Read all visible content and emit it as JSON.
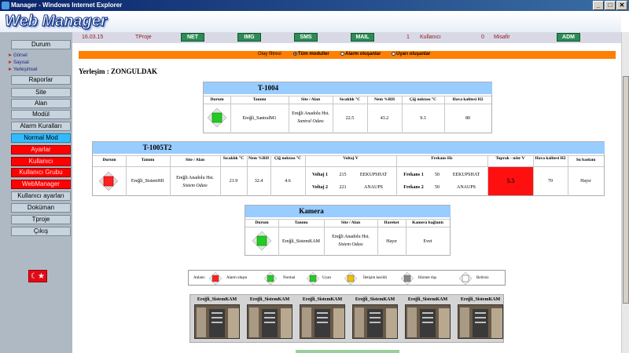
{
  "window": {
    "title": "Manager - Windows Internet Explorer",
    "min": "_",
    "max": "□",
    "close": "✕"
  },
  "app": {
    "logo": "Web Manager"
  },
  "status": {
    "date": "16.03.15",
    "project": "TProje",
    "buttons": [
      "NET",
      "IMG",
      "SMS",
      "MAIL",
      "ADM"
    ],
    "user_count": "1",
    "user_label": "Kullanıcı",
    "guest_count": "0",
    "guest_label": "Misafir"
  },
  "menu": {
    "durum": "Durum",
    "sub": [
      "Görsel",
      "Sayısal",
      "Yerleşimsel"
    ],
    "items": [
      {
        "label": "Raporlar",
        "style": "normal"
      },
      {
        "label": "Site",
        "style": "normal"
      },
      {
        "label": "Alan",
        "style": "normal"
      },
      {
        "label": "Modül",
        "style": "normal"
      },
      {
        "label": "Alarm Kuralları",
        "style": "normal"
      },
      {
        "label": "Normal Mod",
        "style": "cyan"
      },
      {
        "label": "Ayarlar",
        "style": "red"
      },
      {
        "label": "Kullanıcı",
        "style": "red"
      },
      {
        "label": "Kullanıcı Grubu",
        "style": "red"
      },
      {
        "label": "WebManager",
        "style": "red"
      },
      {
        "label": "Kullanıcı ayarları",
        "style": "normal"
      },
      {
        "label": "Doküman",
        "style": "normal"
      },
      {
        "label": "Tproje",
        "style": "normal"
      },
      {
        "label": "Çıkış",
        "style": "normal"
      }
    ]
  },
  "filter": {
    "label": "Olay filtresi",
    "options": [
      "Tüm moduller",
      "Alarm oluşanlar",
      "Uyarı oluşanlar"
    ],
    "selected": "Tüm moduller"
  },
  "location": "Yerleşim : ZONGULDAK",
  "panel1": {
    "title": "T-1004",
    "headers": [
      "Durum",
      "Tanımı",
      "Site / Alan",
      "Sıcaklık °C",
      "Nem %RH",
      "Çiğ noktası °C",
      "Hava kalitesi H2"
    ],
    "row": {
      "status": "normal",
      "name": "Ereğli_SantralM1",
      "site": "Ereğli Anadolu Hst.",
      "area": "Santral Odası",
      "temp": "22.5",
      "humidity": "43.2",
      "dew": "9.3",
      "air": "80"
    }
  },
  "panel2": {
    "title": "T-1005T2",
    "headers": [
      "Durum",
      "Tanımı",
      "Site / Alan",
      "Sıcaklık °C",
      "Nem %RH",
      "Çiğ noktası °C",
      "Voltaj V",
      "Frekans Hz",
      "Toprak - nötr V",
      "Hava kalitesi H2",
      "Su baskını"
    ],
    "row": {
      "status": "alarm",
      "name": "Ereğli_SistemM1",
      "site": "Ereğli Anadolu Hst.",
      "area": "Sistem Odası",
      "temp": "21.9",
      "humidity": "32.4",
      "dew": "4.6",
      "v1_label": "Voltaj 1",
      "v1": "215",
      "v1_name": "EEKUPSHAT",
      "v2_label": "Voltaj 2",
      "v2": "221",
      "v2_name": "ANAUPS",
      "f1_label": "Frekans 1",
      "f1": "50",
      "f1_name": "EEKUPSHAT",
      "f2_label": "Frekans 2",
      "f2": "50",
      "f2_name": "ANAUPS",
      "earth": "5.5",
      "air": "70",
      "flood": "Hayır"
    }
  },
  "panel3": {
    "title": "Kamera",
    "headers": [
      "Durum",
      "Tanımı",
      "Site / Alan",
      "Hareket",
      "Kamera bağlantı"
    ],
    "row": {
      "status": "normal",
      "name": "Ereğli_SistemKAM",
      "site": "Ereğli Anadolu Hst.",
      "area": "Sistem Odası",
      "motion": "Hayır",
      "conn": "Evet"
    }
  },
  "legend": {
    "title": "Anlam:",
    "items": [
      {
        "label": "Alarm oluştu",
        "color": "#ff2020"
      },
      {
        "label": "Normal",
        "color": "#22cc22"
      },
      {
        "label": "Uyarı",
        "color": "#22cc22"
      },
      {
        "label": "İletişim kesildi",
        "color": "#f0c000"
      },
      {
        "label": "Hizmet dışı",
        "color": "#888888"
      },
      {
        "label": "Belirsiz",
        "color": "#ffffff"
      }
    ]
  },
  "cameras": [
    "Ereğli_SistemKAM",
    "Ereğli_SistemKAM",
    "Ereğli_SistemKAM",
    "Ereğli_SistemKAM",
    "Ereğli_SistemKAM",
    "Ereğli_SistemKAM"
  ]
}
